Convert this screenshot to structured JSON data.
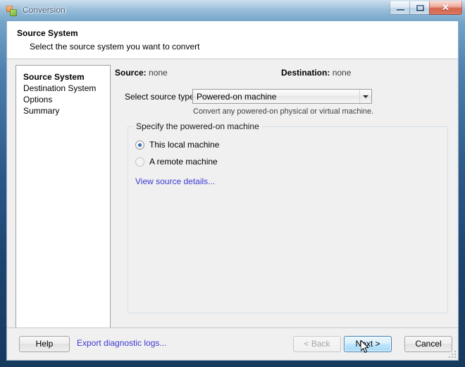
{
  "window": {
    "title": "Conversion",
    "icon": "vmware-converter-icon",
    "controls": {
      "minimize": "minimize-button",
      "maximize": "maximize-button",
      "close_glyph": "✕"
    }
  },
  "header": {
    "title": "Source System",
    "subtitle": "Select the source system you want to convert"
  },
  "sidebar": {
    "items": [
      {
        "label": "Source System",
        "active": true
      },
      {
        "label": "Destination System",
        "active": false
      },
      {
        "label": "Options",
        "active": false
      },
      {
        "label": "Summary",
        "active": false
      }
    ]
  },
  "main": {
    "source": {
      "label": "Source:",
      "value": "none"
    },
    "destination": {
      "label": "Destination:",
      "value": "none"
    },
    "source_type": {
      "label": "Select source type:",
      "selected": "Powered-on machine",
      "options": [
        "Powered-on machine"
      ],
      "hint": "Convert any powered-on physical or virtual machine."
    },
    "group": {
      "legend": "Specify the powered-on machine",
      "radios": [
        {
          "label": "This local machine",
          "checked": true,
          "enabled": true
        },
        {
          "label": "A remote machine",
          "checked": false,
          "enabled": false
        }
      ],
      "details_link": "View source details..."
    }
  },
  "footer": {
    "help": "Help",
    "export_logs": "Export diagnostic logs...",
    "back": "< Back",
    "next": "Next >",
    "cancel": "Cancel"
  },
  "colors": {
    "link": "#3b39d4",
    "accent": "#2f6cb5",
    "frame": "#2d5b8c",
    "surface": "#f0f0f0",
    "header_bg": "#ffffff",
    "close_button": "#c6361d"
  }
}
